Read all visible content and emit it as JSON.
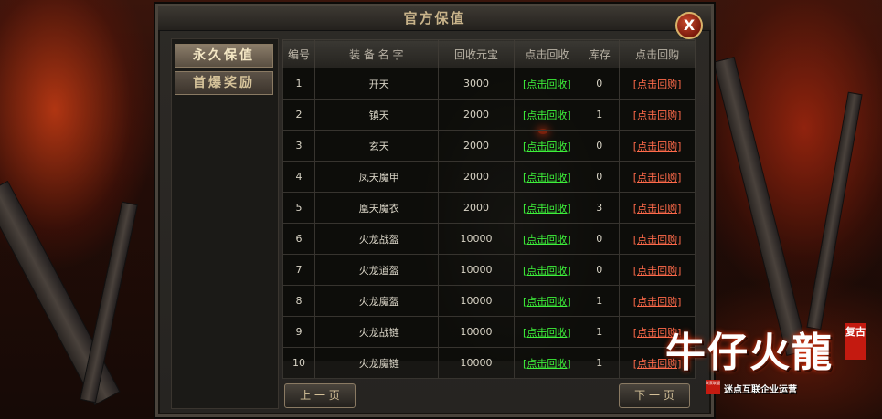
{
  "window": {
    "title": "官方保值",
    "close_label": "X"
  },
  "sidebar": {
    "items": [
      {
        "label": "永久保值",
        "active": true
      },
      {
        "label": "首爆奖励",
        "active": false
      }
    ]
  },
  "table": {
    "headers": [
      "编号",
      "装 备 名 字",
      "回收元宝",
      "点击回收",
      "库存",
      "点击回购"
    ],
    "rows": [
      {
        "no": "1",
        "name": "开天",
        "price": "3000",
        "recycle": "[点击回收]",
        "stock": "0",
        "buyback": "[点击回购]"
      },
      {
        "no": "2",
        "name": "镇天",
        "price": "2000",
        "recycle": "[点击回收]",
        "stock": "1",
        "buyback": "[点击回购]"
      },
      {
        "no": "3",
        "name": "玄天",
        "price": "2000",
        "recycle": "[点击回收]",
        "stock": "0",
        "buyback": "[点击回购]"
      },
      {
        "no": "4",
        "name": "凤天魔甲",
        "price": "2000",
        "recycle": "[点击回收]",
        "stock": "0",
        "buyback": "[点击回购]"
      },
      {
        "no": "5",
        "name": "凰天魔衣",
        "price": "2000",
        "recycle": "[点击回收]",
        "stock": "3",
        "buyback": "[点击回购]"
      },
      {
        "no": "6",
        "name": "火龙战盔",
        "price": "10000",
        "recycle": "[点击回收]",
        "stock": "0",
        "buyback": "[点击回购]"
      },
      {
        "no": "7",
        "name": "火龙道盔",
        "price": "10000",
        "recycle": "[点击回收]",
        "stock": "0",
        "buyback": "[点击回购]"
      },
      {
        "no": "8",
        "name": "火龙魔盔",
        "price": "10000",
        "recycle": "[点击回收]",
        "stock": "1",
        "buyback": "[点击回购]"
      },
      {
        "no": "9",
        "name": "火龙战链",
        "price": "10000",
        "recycle": "[点击回收]",
        "stock": "1",
        "buyback": "[点击回购]"
      },
      {
        "no": "10",
        "name": "火龙魔链",
        "price": "10000",
        "recycle": "[点击回收]",
        "stock": "1",
        "buyback": "[点击回购]"
      }
    ]
  },
  "pagination": {
    "prev_label": "上 一 页",
    "next_label": "下 一 页"
  },
  "logo": {
    "title": "牛仔火龍",
    "badge": "复古",
    "subtitle": "迷点互联企业运营",
    "seal": "联家联盟"
  },
  "colors": {
    "item_name": "#44e040",
    "recycle_link": "#3df03a",
    "buyback_link": "#ff6a4a",
    "frame_text": "#c8b38a"
  }
}
